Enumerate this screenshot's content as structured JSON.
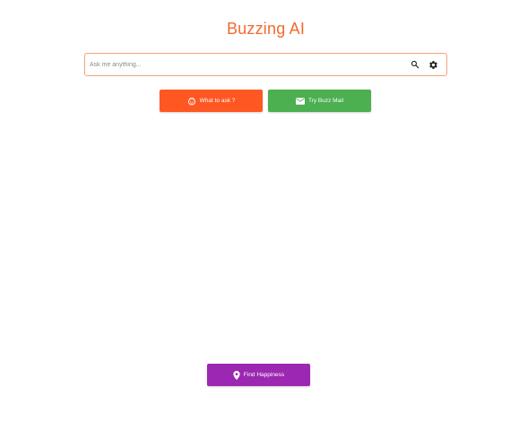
{
  "app": {
    "title": "Buzzing AI"
  },
  "search": {
    "placeholder": "Ask me anything...",
    "value": "",
    "search_icon": "search-icon",
    "settings_icon": "gear-icon"
  },
  "buttons": {
    "ask": {
      "label": "What to ask ?",
      "icon": "face-icon",
      "color": "#ff5722"
    },
    "mail": {
      "label": "Try Buzz Mail",
      "icon": "mail-icon",
      "color": "#4caf50"
    },
    "happiness": {
      "label": "Find Happiness",
      "icon": "location-pin-icon",
      "color": "#9c27b0"
    }
  },
  "colors": {
    "accent": "#f26a2e",
    "search_border": "#f3a27a"
  }
}
